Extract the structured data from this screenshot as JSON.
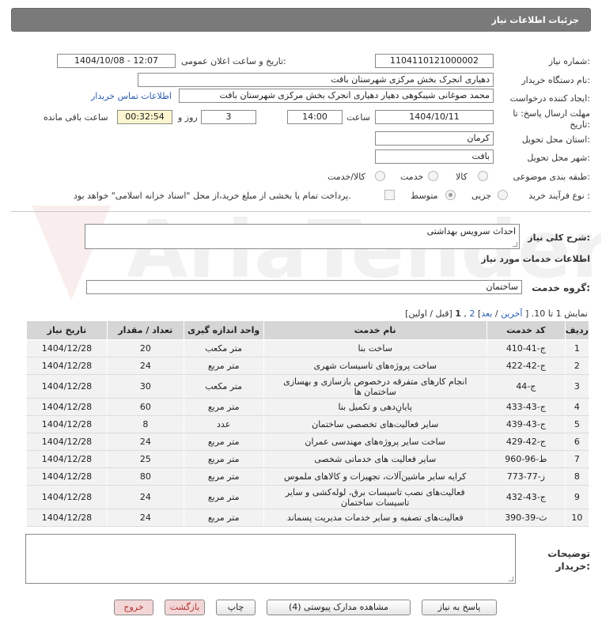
{
  "header": {
    "title": "جزئیات اطلاعات نیاز"
  },
  "form": {
    "need_number_label": "شماره نیاز:",
    "need_number": "1104110121000002",
    "announce_label": "تاریخ و ساعت اعلان عمومی:",
    "announce_value": "1404/10/08 - 12:07",
    "buyer_org_label": "نام دستگاه خریدار:",
    "buyer_org": "دهیاری انجرک بخش مرکزی شهرستان بافت",
    "creator_label": "ایجاد کننده درخواست:",
    "creator": "محمد صوغانی شیبکوهی دهیار دهیاری انجرک بخش مرکزی شهرستان بافت",
    "contact_link": "اطلاعات تماس خریدار",
    "deadline_label_1": "مهلت ارسال پاسخ: تا",
    "deadline_label_2": "تاریخ:",
    "deadline_date": "1404/10/11",
    "time_label": "ساعت",
    "deadline_time": "14:00",
    "days_value": "3",
    "days_label": "روز و",
    "remaining_time": "00:32:54",
    "remaining_label": "ساعت باقی مانده",
    "province_label": "استان محل تحویل:",
    "province": "کرمان",
    "city_label": "شهر محل تحویل:",
    "city": "بافت",
    "category_label": "طبقه بندی موضوعی:",
    "category_options": [
      "کالا",
      "خدمت",
      "کالا/خدمت"
    ],
    "process_label": "نوع فرآیند خرید :",
    "process_options": [
      "جزیی",
      "متوسط"
    ],
    "payment_note": "پرداخت تمام یا بخشی از مبلغ خرید،از محل \"اسناد خزانه اسلامی\" خواهد بود."
  },
  "summary": {
    "label": "شرح کلی نیاز:",
    "value": "احداث سرویس بهداشتی"
  },
  "services": {
    "section_title": "اطلاعات خدمات مورد نیاز",
    "group_label": "گروه خدمت:",
    "group_value": "ساختمان",
    "paging_prefix": "نمایش 1 تا 10. [",
    "paging_last": "آخرین",
    "paging_next": "بعد",
    "paging_page2": "2",
    "paging_page1": "1",
    "paging_suffix": "[قبل / اولین]",
    "columns": [
      "ردیف",
      "کد خدمت",
      "نام خدمت",
      "واحد اندازه گیری",
      "تعداد / مقدار",
      "تاریخ نیاز"
    ],
    "rows": [
      {
        "n": "1",
        "code": "ج-41-410",
        "name": "ساخت بنا",
        "unit": "متر مکعب",
        "qty": "20",
        "date": "1404/12/28"
      },
      {
        "n": "2",
        "code": "ج-42-422",
        "name": "ساخت پروژه‌های تاسیسات شهری",
        "unit": "متر مربع",
        "qty": "24",
        "date": "1404/12/28"
      },
      {
        "n": "3",
        "code": "ج-44",
        "name": "انجام کارهای متفرقه درخصوص بازسازی و بهسازی ساختمان ها",
        "unit": "متر مکعب",
        "qty": "30",
        "date": "1404/12/28"
      },
      {
        "n": "4",
        "code": "ج-43-433",
        "name": "پایانِ‌دهی و تکمیل بنا",
        "unit": "متر مربع",
        "qty": "60",
        "date": "1404/12/28"
      },
      {
        "n": "5",
        "code": "ج-43-439",
        "name": "سایر فعالیت‌های تخصصی ساختمان",
        "unit": "عدد",
        "qty": "8",
        "date": "1404/12/28"
      },
      {
        "n": "6",
        "code": "ج-42-429",
        "name": "ساخت سایر پروژه‌های مهندسی عمران",
        "unit": "متر مربع",
        "qty": "24",
        "date": "1404/12/28"
      },
      {
        "n": "7",
        "code": "ط-96-960",
        "name": "سایر فعالیت های خدماتی شخصی",
        "unit": "متر مربع",
        "qty": "25",
        "date": "1404/12/28"
      },
      {
        "n": "8",
        "code": "ز-77-773",
        "name": "کرایه سایر ماشین‌آلات، تجهیزات و کالاهای ملموس",
        "unit": "متر مربع",
        "qty": "80",
        "date": "1404/12/28"
      },
      {
        "n": "9",
        "code": "ج-43-432",
        "name": "فعالیت‌های نصب تاسیسات برق، لوله‌کشی و سایر تاسیسات ساختمان",
        "unit": "متر مربع",
        "qty": "24",
        "date": "1404/12/28"
      },
      {
        "n": "10",
        "code": "ث-39-390",
        "name": "فعالیت‌های تصفیه و سایر خدمات مدیریت پسماند",
        "unit": "متر مربع",
        "qty": "24",
        "date": "1404/12/28"
      }
    ]
  },
  "buyer_notes": {
    "label_1": "توضیحات",
    "label_2": "خریدار:"
  },
  "buttons": {
    "reply": "پاسخ به نیاز",
    "attachments": "مشاهده مدارک پیوستی (4)",
    "print": "چاپ",
    "back": "بازگشت",
    "exit": "خروج"
  },
  "watermark": {
    "text": "AriaTender.neT"
  }
}
